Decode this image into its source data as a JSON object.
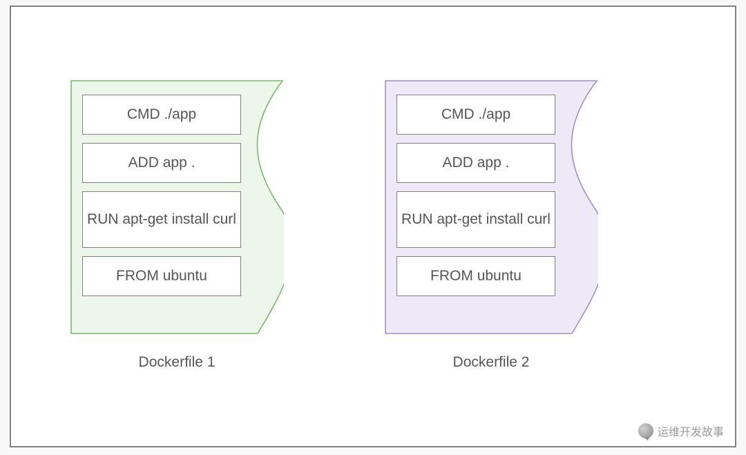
{
  "dockerfiles": [
    {
      "label": "Dockerfile 1",
      "fill": "#ecf7ea",
      "stroke": "#7ab66f",
      "layers": [
        "CMD ./app",
        "ADD app .",
        "RUN apt-get install curl",
        "FROM ubuntu"
      ]
    },
    {
      "label": "Dockerfile 2",
      "fill": "#eee9f7",
      "stroke": "#a08fc6",
      "layers": [
        "CMD ./app",
        "ADD app .",
        "RUN apt-get install curl",
        "FROM ubuntu"
      ]
    }
  ],
  "watermark": "运维开发故事"
}
